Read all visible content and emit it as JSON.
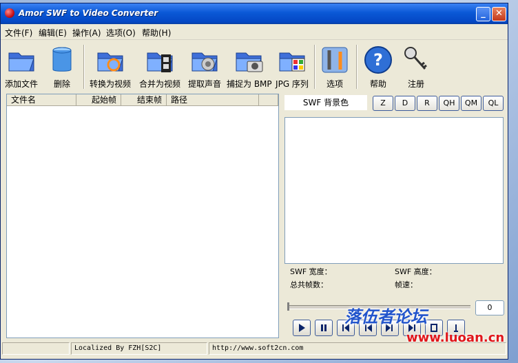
{
  "window": {
    "title": "Amor SWF to Video Converter"
  },
  "menu": [
    "文件(F)",
    "编辑(E)",
    "操作(A)",
    "选项(O)",
    "帮助(H)"
  ],
  "toolbar": {
    "add_file": "添加文件",
    "delete": "删除",
    "convert_video": "转换为视频",
    "merge_video": "合并为视频",
    "extract_audio": "提取声音",
    "capture_bmp": "捕捉为 BMP",
    "jpg_sequence": "JPG 序列",
    "options": "选项",
    "help": "帮助",
    "register": "注册"
  },
  "file_list": {
    "columns": [
      "文件名",
      "起始帧",
      "结束帧",
      "路径"
    ]
  },
  "preview": {
    "bg_color_label": "SWF 背景色",
    "quality_buttons": [
      "Z",
      "D",
      "R",
      "QH",
      "QM",
      "QL"
    ],
    "swf_width_label": "SWF 宽度：",
    "swf_height_label": "SWF 高度：",
    "total_frames_label": "总共帧数：",
    "frame_rate_label": "帧速：",
    "frame_counter": "0"
  },
  "status": {
    "localized": "Localized By FZH[S2C]",
    "url": "http://www.soft2cn.com"
  },
  "watermark": {
    "line1": "落伍者论坛",
    "line2": "www.luoan.cn"
  },
  "colors": {
    "titlebar": "#0a58d6",
    "window_bg": "#ece9d8",
    "accent": "#3c5a99"
  }
}
